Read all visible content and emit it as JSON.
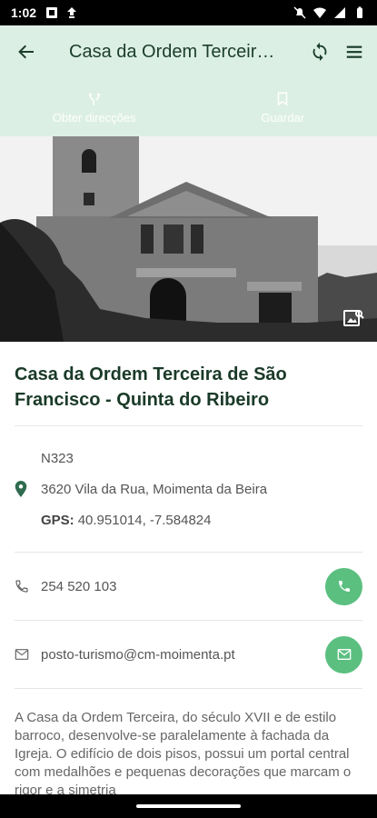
{
  "status_bar": {
    "time": "1:02",
    "left_icons": [
      "photo-icon",
      "download-icon"
    ],
    "right_icons": [
      "mute-icon",
      "wifi-icon",
      "signal-icon",
      "battery-icon"
    ]
  },
  "app_bar": {
    "title": "Casa da Ordem Terceira de São Francisco - Quinta do Ribeiro",
    "back_icon": "arrow-back-icon",
    "sync_icon": "sync-icon",
    "menu_icon": "menu-icon"
  },
  "actions": {
    "directions_label": "Obter direcções",
    "save_label": "Guardar"
  },
  "place": {
    "title": "Casa da Ordem Terceira de São Francisco - Quinta do Ribeiro",
    "road": "N323",
    "address": "3620 Vila da Rua, Moimenta da Beira",
    "gps_label": "GPS:",
    "gps_value": "40.951014, -7.584824",
    "phone": "254 520 103",
    "email": "posto-turismo@cm-moimenta.pt",
    "description": "A Casa da Ordem Terceira, do século XVII e de estilo barroco, desenvolve-se paralelamente à fachada da Igreja. O edifício de dois pisos, possui um portal central com medalhões e pequenas decorações que marcam o rigor e a simetria"
  },
  "colors": {
    "appbar_bg": "#dcefe4",
    "accent_green": "#5bbf80",
    "title_green": "#1a3a28"
  }
}
